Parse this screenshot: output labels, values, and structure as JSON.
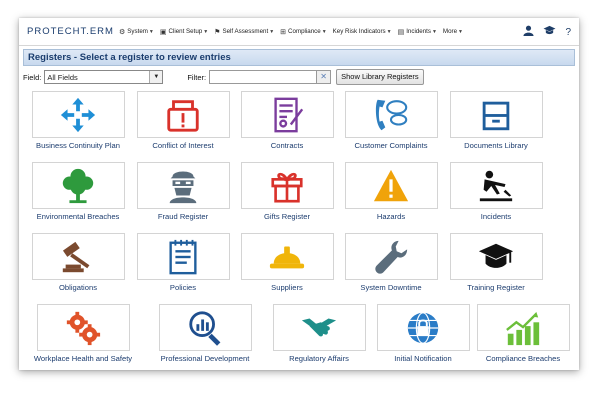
{
  "app": {
    "logo_text": "PROTECHT.ERM"
  },
  "menu": [
    {
      "label": "System",
      "icon": "gear-icon",
      "glyph": "⚙"
    },
    {
      "label": "Client Setup",
      "icon": "clipboard-icon",
      "glyph": "▣"
    },
    {
      "label": "Self Assessment",
      "icon": "run-icon",
      "glyph": "⚑"
    },
    {
      "label": "Compliance",
      "icon": "compliance-icon",
      "glyph": "⊞"
    },
    {
      "label": "Key Risk Indicators",
      "icon": "",
      "glyph": ""
    },
    {
      "label": "Incidents",
      "icon": "incident-icon",
      "glyph": "▤"
    },
    {
      "label": "More",
      "icon": "",
      "glyph": ""
    }
  ],
  "top_right": {
    "user_icon": "user-icon",
    "cap_icon": "graduation-cap-icon",
    "help": "?"
  },
  "panel": {
    "title": "Registers - Select a register to review entries"
  },
  "filter": {
    "field_label": "Field:",
    "field_value": "All Fields",
    "filter_label": "Filter:",
    "filter_value": "",
    "library_button": "Show Library Registers"
  },
  "registers": [
    {
      "label": "Business Continuity Plan",
      "icon": "move-arrows-icon",
      "color": "#1f8fd6"
    },
    {
      "label": "Conflict of Interest",
      "icon": "alert-box-icon",
      "color": "#d9322b"
    },
    {
      "label": "Contracts",
      "icon": "contract-icon",
      "color": "#7b3d9d"
    },
    {
      "label": "Customer Complaints",
      "icon": "phone-chat-icon",
      "color": "#2f7fc0"
    },
    {
      "label": "Documents Library",
      "icon": "file-cabinet-icon",
      "color": "#1f5e9c"
    },
    {
      "label": "Environmental Breaches",
      "icon": "tree-icon",
      "color": "#2e9a3d"
    },
    {
      "label": "Fraud Register",
      "icon": "burglar-icon",
      "color": "#5b6d7c"
    },
    {
      "label": "Gifts Register",
      "icon": "gift-icon",
      "color": "#d9322b"
    },
    {
      "label": "Hazards",
      "icon": "warning-icon",
      "color": "#f0a30a"
    },
    {
      "label": "Incidents",
      "icon": "slip-fall-icon",
      "color": "#111111"
    },
    {
      "label": "Obligations",
      "icon": "gavel-icon",
      "color": "#7b4a2f"
    },
    {
      "label": "Policies",
      "icon": "notepad-icon",
      "color": "#1f5e9c"
    },
    {
      "label": "Suppliers",
      "icon": "hard-hat-icon",
      "color": "#f0b50a"
    },
    {
      "label": "System Downtime",
      "icon": "wrench-icon",
      "color": "#5b6d7c"
    },
    {
      "label": "Training Register",
      "icon": "graduation-cap-icon",
      "color": "#111111"
    },
    {
      "label": "Workplace Health and Safety",
      "icon": "gears-icon",
      "color": "#e0532a"
    },
    {
      "label": "Professional Development",
      "icon": "magnifier-chart-icon",
      "color": "#1f4f8f"
    },
    {
      "label": "Regulatory Affairs",
      "icon": "handshake-icon",
      "color": "#1e8f8a"
    },
    {
      "label": "Initial Notification",
      "icon": "globe-lock-icon",
      "color": "#2a7cc7"
    },
    {
      "label": "Compliance Breaches",
      "icon": "trend-chart-icon",
      "color": "#6cbf3a"
    }
  ]
}
